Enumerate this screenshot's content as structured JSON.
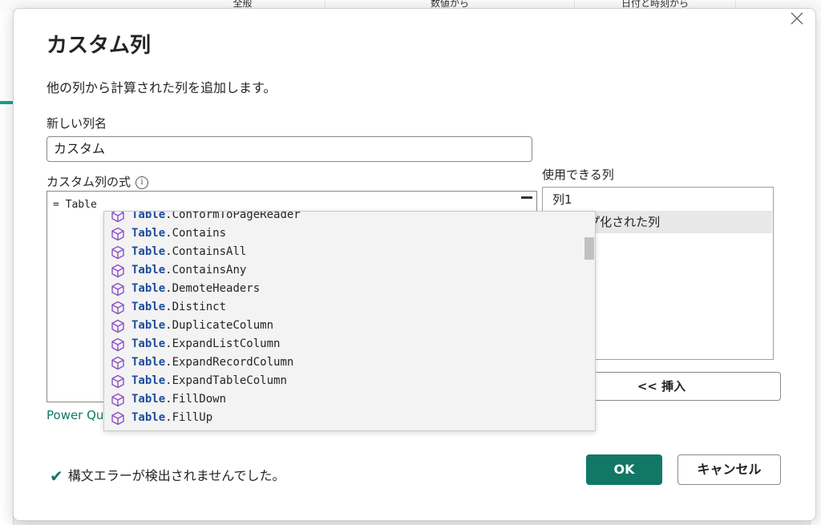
{
  "background": {
    "tabs": [
      "全般",
      "数値から",
      "日付と時刻から"
    ]
  },
  "dialog": {
    "title": "カスタム列",
    "close_icon": "close-icon",
    "description": "他の列から計算された列を追加します。",
    "new_column_label": "新しい列名",
    "new_column_value": "カスタム",
    "formula_label": "カスタム列の式",
    "formula_info_icon": "info-icon",
    "formula_text": "= Table",
    "available_columns_label": "使用できる列",
    "available_columns": [
      "列1",
      "グループ化された列"
    ],
    "insert_button": "<< 挿入",
    "power_query_link": "Power Qu",
    "status_text": "構文エラーが検出されませんでした。",
    "status_icon": "check-icon",
    "ok_button": "OK",
    "cancel_button": "キャンセル"
  },
  "autocomplete": {
    "item_icon": "cube-icon",
    "prefix": "Table",
    "items": [
      ".ConformToPageReader",
      ".Contains",
      ".ContainsAll",
      ".ContainsAny",
      ".DemoteHeaders",
      ".Distinct",
      ".DuplicateColumn",
      ".ExpandListColumn",
      ".ExpandRecordColumn",
      ".ExpandTableColumn",
      ".FillDown",
      ".FillUp"
    ]
  },
  "colors": {
    "accent": "#117865",
    "keyword": "#1f4e9c",
    "icon": "#8b4fc7"
  }
}
